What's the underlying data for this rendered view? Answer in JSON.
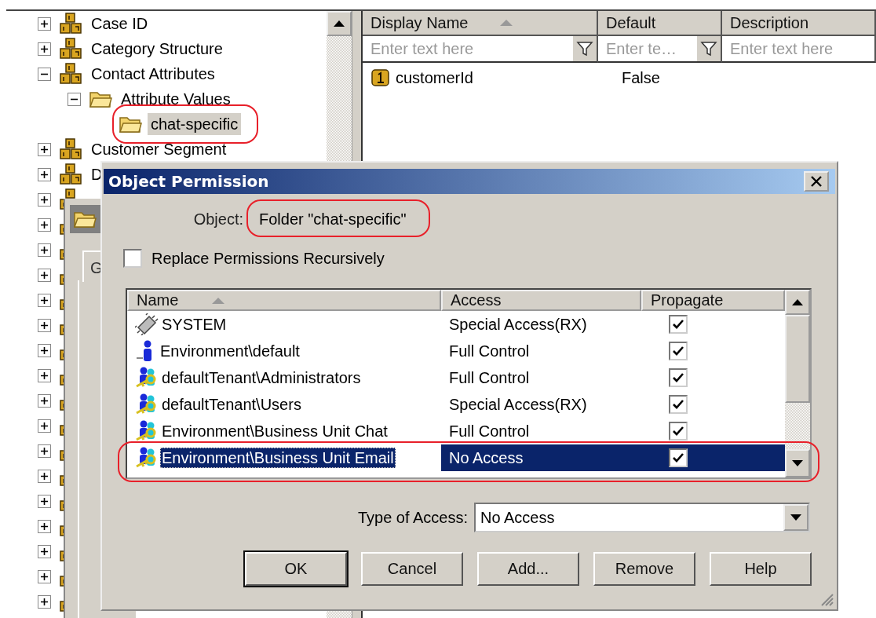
{
  "tree": {
    "items": [
      {
        "label": "Case ID",
        "kind": "category",
        "expanded": false,
        "selected": false
      },
      {
        "label": "Category Structure",
        "kind": "category",
        "expanded": false,
        "selected": false
      },
      {
        "label": "Contact Attributes",
        "kind": "category",
        "expanded": true,
        "selected": false,
        "children": [
          {
            "label": "Attribute Values",
            "kind": "folder",
            "expanded": true,
            "selected": false,
            "children": [
              {
                "label": "chat-specific",
                "kind": "folder",
                "selected": true
              }
            ]
          }
        ]
      },
      {
        "label": "Customer Segment",
        "kind": "category",
        "expanded": false,
        "selected": false
      },
      {
        "label": "D",
        "kind": "category",
        "expanded": false,
        "selected": false
      },
      {
        "kind": "category",
        "expanded": false
      },
      {
        "kind": "category",
        "expanded": false
      },
      {
        "kind": "category",
        "expanded": false
      },
      {
        "kind": "category",
        "expanded": false
      },
      {
        "kind": "category",
        "expanded": false
      },
      {
        "kind": "category",
        "expanded": false
      },
      {
        "kind": "category",
        "expanded": false
      },
      {
        "kind": "category",
        "expanded": false
      },
      {
        "kind": "category",
        "expanded": false
      },
      {
        "kind": "category",
        "expanded": false
      },
      {
        "kind": "category",
        "expanded": false
      },
      {
        "kind": "category",
        "expanded": false
      },
      {
        "kind": "category",
        "expanded": false
      },
      {
        "kind": "category",
        "expanded": false
      },
      {
        "kind": "category",
        "expanded": false
      },
      {
        "kind": "category",
        "expanded": false
      },
      {
        "kind": "category",
        "expanded": false
      }
    ]
  },
  "grid": {
    "columns": [
      {
        "label": "Display Name",
        "sorted": true,
        "placeholder": "Enter text here",
        "filter_button": true
      },
      {
        "label": "Default",
        "sorted": false,
        "placeholder": "Enter te…",
        "filter_button": true
      },
      {
        "label": "Description",
        "sorted": false,
        "placeholder": "Enter text here",
        "filter_button": false
      }
    ],
    "rows": [
      {
        "kind": "attribute",
        "cells": [
          "customerId",
          "False"
        ]
      }
    ]
  },
  "back_window": {
    "tab": "G"
  },
  "dialog": {
    "title": "Object Permission",
    "object_label": "Object:",
    "object_value": "Folder \"chat-specific\"",
    "recursive": {
      "label": "Replace Permissions Recursively",
      "checked": false
    },
    "list": {
      "columns": [
        {
          "label": "Name",
          "sorted": true
        },
        {
          "label": "Access",
          "sorted": false
        },
        {
          "label": "Propagate",
          "sorted": false
        }
      ],
      "rows": [
        {
          "name": "SYSTEM",
          "kind": "system",
          "access": "Special Access(RX)",
          "propagate": true,
          "selected": false
        },
        {
          "name": "Environment\\default",
          "kind": "user",
          "access": "Full Control",
          "propagate": true,
          "selected": false
        },
        {
          "name": "defaultTenant\\Administrators",
          "kind": "group",
          "access": "Full Control",
          "propagate": true,
          "selected": false
        },
        {
          "name": "defaultTenant\\Users",
          "kind": "group",
          "access": "Special Access(RX)",
          "propagate": true,
          "selected": false
        },
        {
          "name": "Environment\\Business Unit Chat",
          "kind": "group",
          "access": "Full Control",
          "propagate": true,
          "selected": false
        },
        {
          "name": "Environment\\Business Unit Email",
          "kind": "group",
          "access": "No Access",
          "propagate": true,
          "selected": true
        }
      ]
    },
    "type_of_access": {
      "label": "Type of Access:",
      "value": "No Access"
    },
    "buttons": [
      {
        "label": "OK",
        "default": true
      },
      {
        "label": "Cancel",
        "default": false
      },
      {
        "label": "Add...",
        "default": false
      },
      {
        "label": "Remove",
        "default": false
      },
      {
        "label": "Help",
        "default": false
      }
    ]
  }
}
